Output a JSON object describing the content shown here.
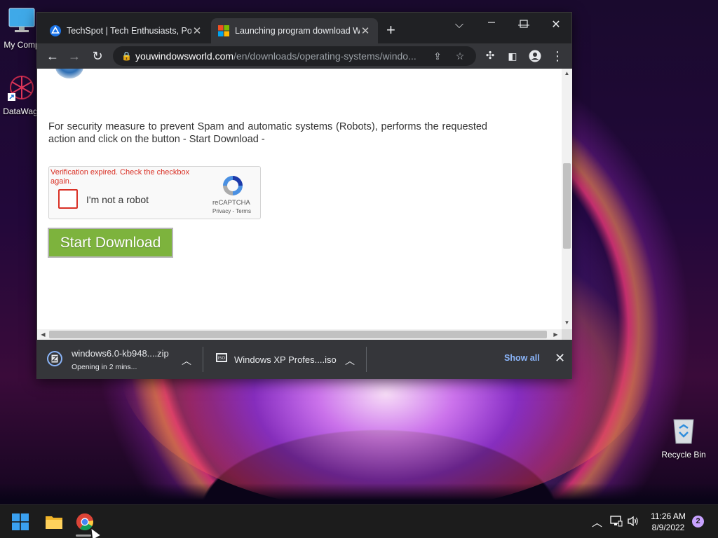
{
  "desktop": {
    "icons": [
      {
        "label": "My Comp",
        "icon": "monitor-icon"
      },
      {
        "label": "DataWag",
        "icon": "datawag-app-icon"
      },
      {
        "label": "Recycle Bin",
        "icon": "recycle-bin-icon"
      }
    ]
  },
  "browser": {
    "tabs": [
      {
        "title": "TechSpot | Tech Enthusiasts, Powe",
        "favicon": "techspot-icon",
        "active": false
      },
      {
        "title": "Launching program download W",
        "favicon": "windows-logo-icon",
        "active": true
      }
    ],
    "address": {
      "host": "youwindowsworld.com",
      "path": "/en/downloads/operating-systems/windo..."
    }
  },
  "page": {
    "security_text": "For security measure to prevent Spam and automatic systems (Robots), performs the requested action and click on the button - Start Download -",
    "captcha": {
      "error": "Verification expired. Check the checkbox again.",
      "label": "I'm not a robot",
      "brand": "reCAPTCHA",
      "links": "Privacy - Terms"
    },
    "start_button": "Start Download"
  },
  "downloads": {
    "items": [
      {
        "name": "windows6.0-kb948....zip",
        "status": "Opening in 2 mins..."
      },
      {
        "name": "Windows XP Profes....iso",
        "status": ""
      }
    ],
    "show_all": "Show all"
  },
  "taskbar": {
    "time": "11:26 AM",
    "date": "8/9/2022",
    "notifications": "2"
  },
  "colors": {
    "start_button": "#7db33d",
    "captcha_error": "#d93025",
    "link_blue": "#8ab4f8"
  }
}
